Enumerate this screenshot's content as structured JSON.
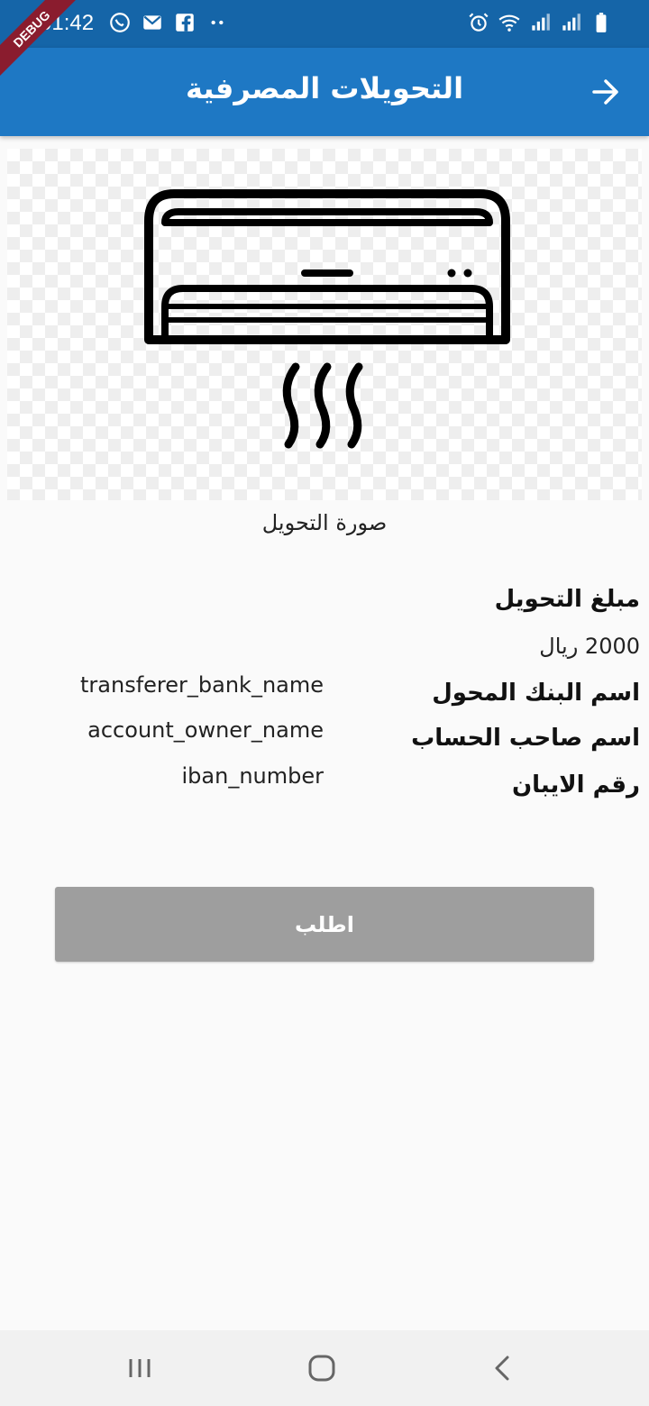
{
  "status_bar": {
    "time": "01:42",
    "debug_label": "DEBUG"
  },
  "app_bar": {
    "title": "التحويلات المصرفية"
  },
  "transfer_image": {
    "caption": "صورة التحويل"
  },
  "details": {
    "amount_label": "مبلغ التحويل",
    "amount_value": "2000 ريال",
    "bank_label": "اسم البنك المحول",
    "bank_value": "transferer_bank_name",
    "owner_label": "اسم صاحب الحساب",
    "owner_value": "account_owner_name",
    "iban_label": "رقم الايبان",
    "iban_value": "iban_number"
  },
  "actions": {
    "request_label": "اطلب"
  },
  "colors": {
    "status_bar": "#1565a8",
    "app_bar": "#1e78c4",
    "button": "#9e9e9e",
    "background": "#fafafa"
  }
}
